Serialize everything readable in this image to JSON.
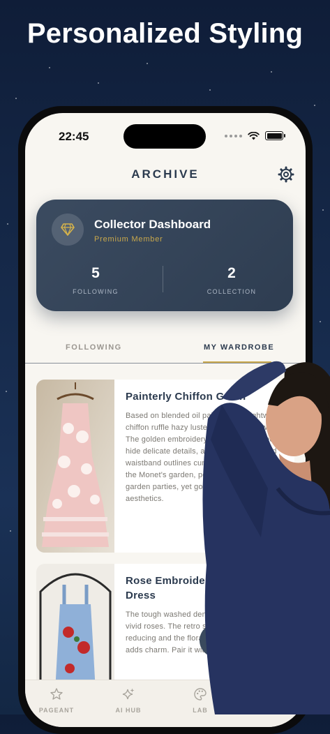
{
  "promo": {
    "headline": "Personalized Styling"
  },
  "status_bar": {
    "time": "22:45"
  },
  "header": {
    "title": "ARCHIVE",
    "settings_icon": "gear-icon"
  },
  "dashboard": {
    "icon": "diamond-icon",
    "title": "Collector Dashboard",
    "subtitle": "Premium Member",
    "stats": [
      {
        "value": "5",
        "label": "FOLLOWING"
      },
      {
        "value": "2",
        "label": "COLLECTION"
      }
    ]
  },
  "tabs": [
    {
      "label": "FOLLOWING",
      "active": false
    },
    {
      "label": "MY WARDROBE",
      "active": true
    }
  ],
  "items": [
    {
      "title": "Painterly Chiffon Gown",
      "description": "Based on blended oil painting, the lightweight chiffon ruffle hazy luster as the light flows. The golden embroidery threads at the neck hide delicate details, and the color-blocked waistband outlines curves. It's like wearing the Monet's garden, perfect for dinners and garden parties, yet gorgeous retro aesthetics."
    },
    {
      "title": "Rose Embroidered Pinafore Dress",
      "description": "The tough washed denim gives a soft soul by vivid roses. The retro square neck and age-reducing and the floral design on the skirt adds charm. Pair it with a white T-shirt."
    }
  ],
  "fab": {
    "label": "+"
  },
  "bottom_nav": [
    {
      "label": "PAGEANT",
      "icon": "star-icon"
    },
    {
      "label": "AI HUB",
      "icon": "sparkles-icon"
    },
    {
      "label": "LAB",
      "icon": "palette-icon"
    }
  ],
  "colors": {
    "accent_gold": "#c9a84b",
    "navy": "#2b3a4e",
    "card_dark": "#34445a",
    "screen_bg": "#f8f6f1"
  }
}
